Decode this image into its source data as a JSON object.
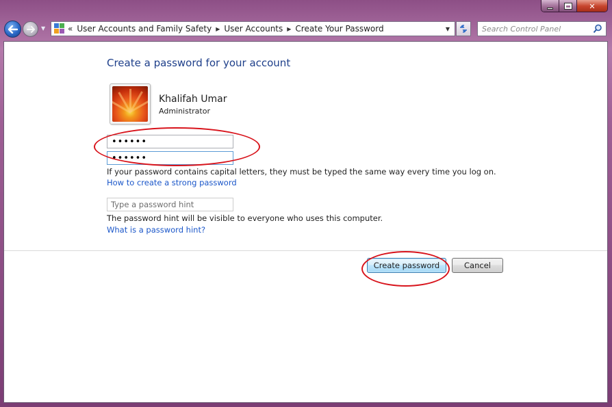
{
  "window": {
    "buttons": [
      "minimize",
      "maximize",
      "close"
    ]
  },
  "nav": {
    "back_icon": "back-arrow-icon",
    "forward_icon": "forward-arrow-icon",
    "breadcrumb_prefix": "«",
    "breadcrumbs": [
      "User Accounts and Family Safety",
      "User Accounts",
      "Create Your Password"
    ],
    "search_placeholder": "Search Control Panel"
  },
  "page": {
    "title": "Create a password for your account",
    "user": {
      "name": "Khalifah Umar",
      "role": "Administrator"
    },
    "new_password_value": "••••••",
    "confirm_password_value": "••••••",
    "capital_note": "If your password contains capital letters, they must be typed the same way every time you log on.",
    "strong_password_link": "How to create a strong password",
    "hint_placeholder": "Type a password hint",
    "hint_note": "The password hint will be visible to everyone who uses this computer.",
    "hint_link": "What is a password hint?",
    "create_button": "Create password",
    "cancel_button": "Cancel"
  },
  "colors": {
    "annotation": "#d8141c",
    "link": "#1a56c9",
    "title": "#1e3f8a"
  }
}
